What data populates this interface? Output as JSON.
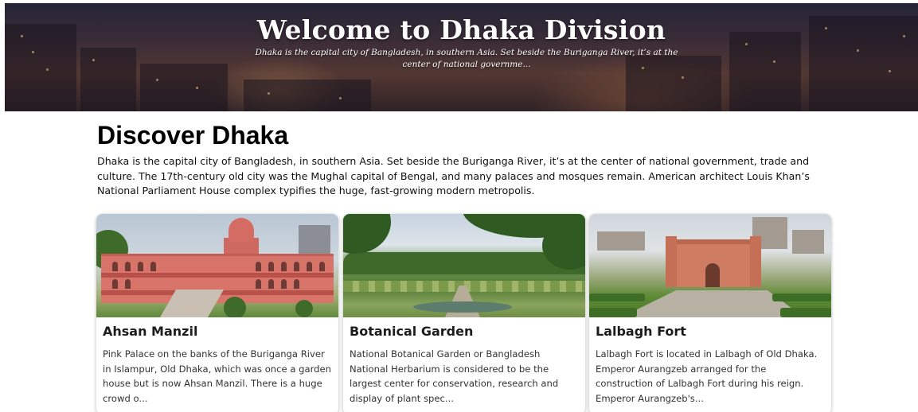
{
  "hero": {
    "title": "Welcome to Dhaka Division",
    "subtitle": "Dhaka is the capital city of Bangladesh, in southern Asia. Set beside the Buriganga River, it’s at the center of national governme..."
  },
  "intro": {
    "heading": "Discover Dhaka",
    "body": "Dhaka is the capital city of Bangladesh, in southern Asia. Set beside the Buriganga River, it’s at the center of national government, trade and culture. The 17th-century old city was the Mughal capital of Bengal, and many palaces and mosques remain. American architect Louis Khan’s National Parliament House complex typifies the huge, fast-growing modern metropolis."
  },
  "cards": [
    {
      "title": "Ahsan Manzil",
      "text": "Pink Palace on the banks of the Buriganga River in Islampur, Old Dhaka, which was once a garden house but is now Ahsan Manzil. There is a huge crowd o..."
    },
    {
      "title": "Botanical Garden",
      "text": "National Botanical Garden or Bangladesh National Herbarium is considered to be the largest center for conservation, research and display of plant spec..."
    },
    {
      "title": "Lalbagh Fort",
      "text": "Lalbagh Fort is located in Lalbagh of Old Dhaka. Emperor Aurangzeb arranged for the construction of Lalbagh Fort during his reign. Emperor Aurangzeb's..."
    }
  ]
}
